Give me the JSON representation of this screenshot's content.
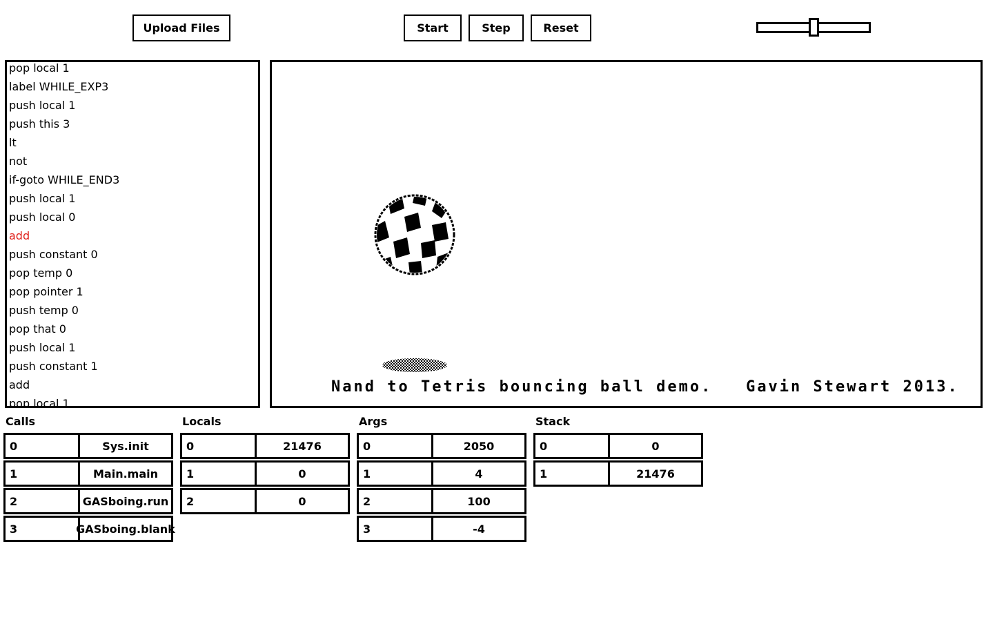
{
  "toolbar": {
    "upload_label": "Upload Files",
    "start_label": "Start",
    "step_label": "Step",
    "reset_label": "Reset"
  },
  "speed_slider": {
    "level_fraction": 0.5
  },
  "code": {
    "lines": [
      "pop local 1",
      "label WHILE_EXP3",
      "push local 1",
      "push this 3",
      "lt",
      "not",
      "if-goto WHILE_END3",
      "push local 1",
      "push local 0",
      "add",
      "push constant 0",
      "pop temp 0",
      "pop pointer 1",
      "push temp 0",
      "pop that 0",
      "push local 1",
      "push constant 1",
      "add",
      "pop local 1"
    ],
    "current_index": 9,
    "highlight_color": "#e0201b"
  },
  "screen": {
    "caption": "Nand to Tetris bouncing ball demo.   Gavin Stewart 2013."
  },
  "calls": {
    "title": "Calls",
    "rows": [
      {
        "index": "0",
        "value": "Sys.init"
      },
      {
        "index": "1",
        "value": "Main.main"
      },
      {
        "index": "2",
        "value": "GASboing.run"
      },
      {
        "index": "3",
        "value": "GASboing.blank"
      }
    ]
  },
  "locals": {
    "title": "Locals",
    "rows": [
      {
        "index": "0",
        "value": "21476"
      },
      {
        "index": "1",
        "value": "0"
      },
      {
        "index": "2",
        "value": "0"
      }
    ]
  },
  "args": {
    "title": "Args",
    "rows": [
      {
        "index": "0",
        "value": "2050"
      },
      {
        "index": "1",
        "value": "4"
      },
      {
        "index": "2",
        "value": "100"
      },
      {
        "index": "3",
        "value": "-4"
      }
    ]
  },
  "stack": {
    "title": "Stack",
    "rows": [
      {
        "index": "0",
        "value": "0"
      },
      {
        "index": "1",
        "value": "21476"
      }
    ]
  }
}
